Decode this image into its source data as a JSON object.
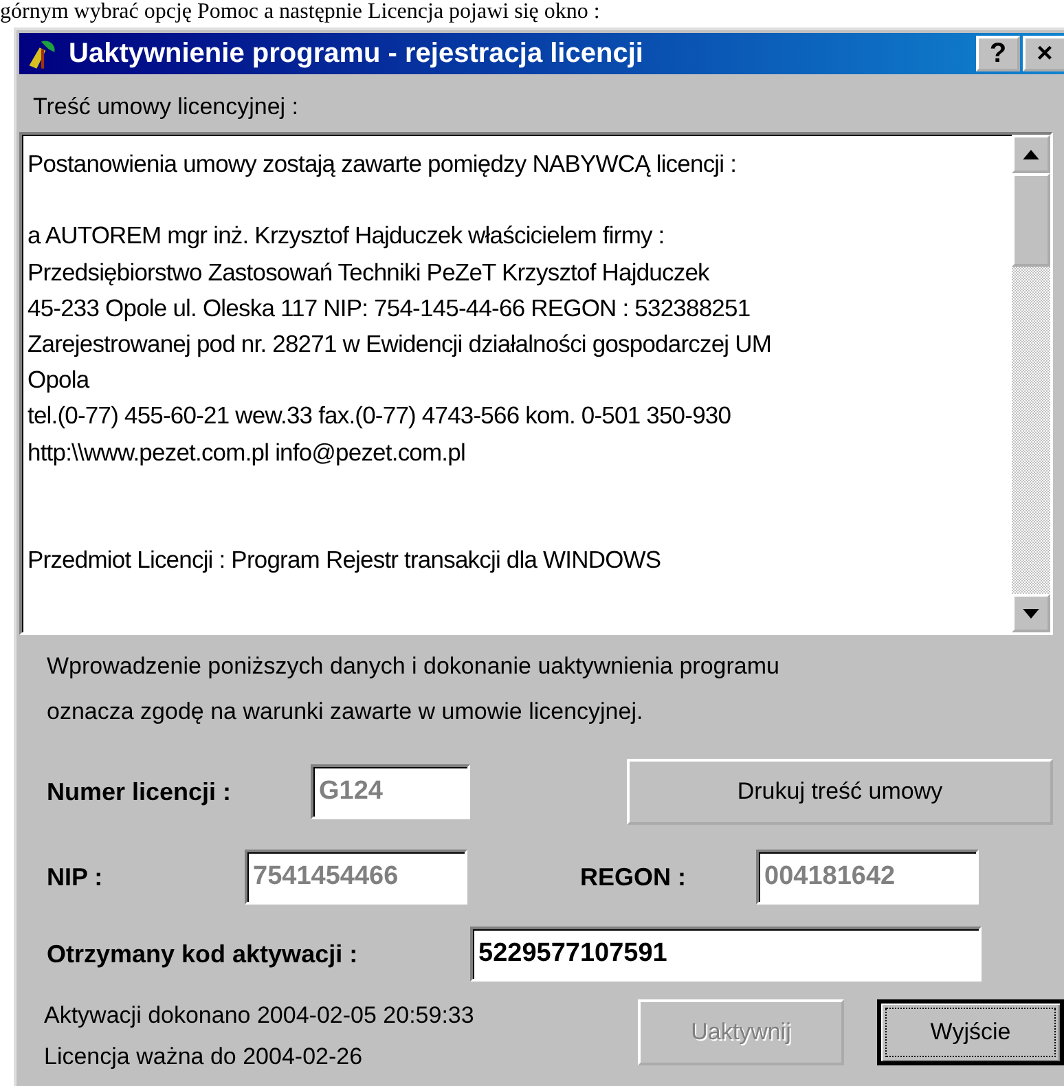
{
  "document_line": "górnym wybrać opcję Pomoc a następnie Licencja pojawi się okno :",
  "window": {
    "title": "Uaktywnienie programu - rejestracja licencji",
    "help_button": "?",
    "close_button": "×"
  },
  "license_label": "Treść umowy licencyjnej :",
  "license_text": [
    {
      "kind": "paragraph",
      "lines": [
        "Postanowienia umowy zostają zawarte pomiędzy NABYWCĄ licencji :"
      ]
    },
    {
      "kind": "paragraph",
      "lines": [
        "a AUTOREM mgr inż. Krzysztof Hajduczek właścicielem firmy :",
        "Przedsiębiorstwo Zastosowań Techniki PeZeT Krzysztof Hajduczek",
        "45-233 Opole ul. Oleska 117 NIP: 754-145-44-66 REGON : 532388251",
        "Zarejestrowanej pod nr. 28271 w Ewidencji działalności gospodarczej UM",
        "Opola",
        "tel.(0-77) 455-60-21 wew.33 fax.(0-77) 4743-566 kom. 0-501 350-930",
        "http:\\\\www.pezet.com.pl    info@pezet.com.pl"
      ]
    },
    {
      "kind": "section",
      "lines": [
        "Przedmiot Licencji : Program Rejestr transakcji dla WINDOWS"
      ]
    }
  ],
  "notice": [
    "Wprowadzenie poniższych danych i dokonanie uaktywnienia programu",
    "oznacza zgodę na warunki zawarte w umowie licencyjnej."
  ],
  "fields": [
    {
      "label": "Numer licencji :",
      "value": "G124",
      "disabled": true
    },
    {
      "label": "NIP :",
      "value": "7541454466",
      "disabled": true
    },
    {
      "label": "REGON :",
      "value": "004181642",
      "disabled": true
    },
    {
      "label": "Otrzymany kod aktywacji :",
      "value": "5229577107591",
      "disabled": false
    }
  ],
  "print_button": {
    "label": "Drukuj treść umowy",
    "disabled": false,
    "focused": false
  },
  "status": [
    "Aktywacji dokonano 2004-02-05 20:59:33",
    "Licencja ważna do 2004-02-26"
  ],
  "buttons": [
    {
      "label": "Uaktywnij",
      "disabled": true,
      "focused": false
    },
    {
      "label": "Wyjście",
      "disabled": false,
      "focused": true
    }
  ]
}
